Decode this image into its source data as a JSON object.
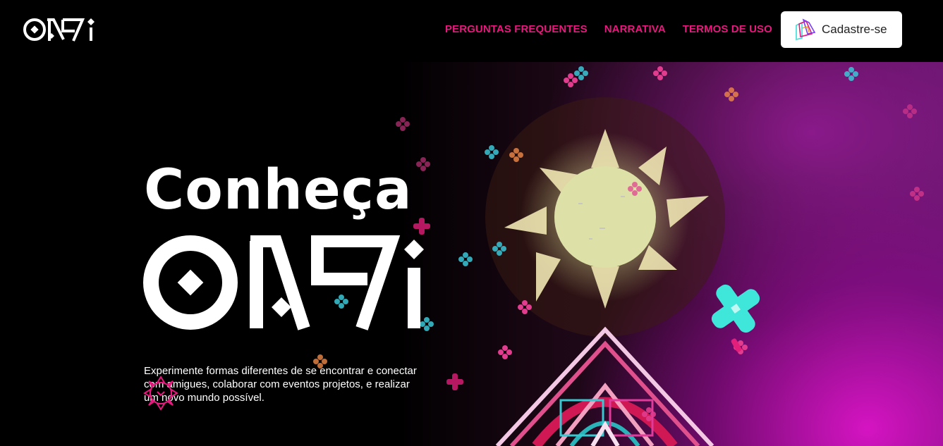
{
  "brand": {
    "name": "ONSI"
  },
  "nav": {
    "items": [
      {
        "label": "PERGUNTAS FREQUENTES"
      },
      {
        "label": "NARRATIVA"
      },
      {
        "label": "TERMOS DE USO"
      }
    ],
    "signup_label": "Cadastre-se"
  },
  "hero": {
    "headline": "Conheça",
    "description": "Experimente formas diferentes de se encontrar e conectar com amigues, colaborar com eventos projetos, e realizar um novo mundo possível.",
    "scroll_icon": "chevron-down-icon"
  },
  "colors": {
    "accent": "#e6197e",
    "background": "#000000",
    "magenta_glow": "#d414c8",
    "cyan": "#38e0d8"
  }
}
